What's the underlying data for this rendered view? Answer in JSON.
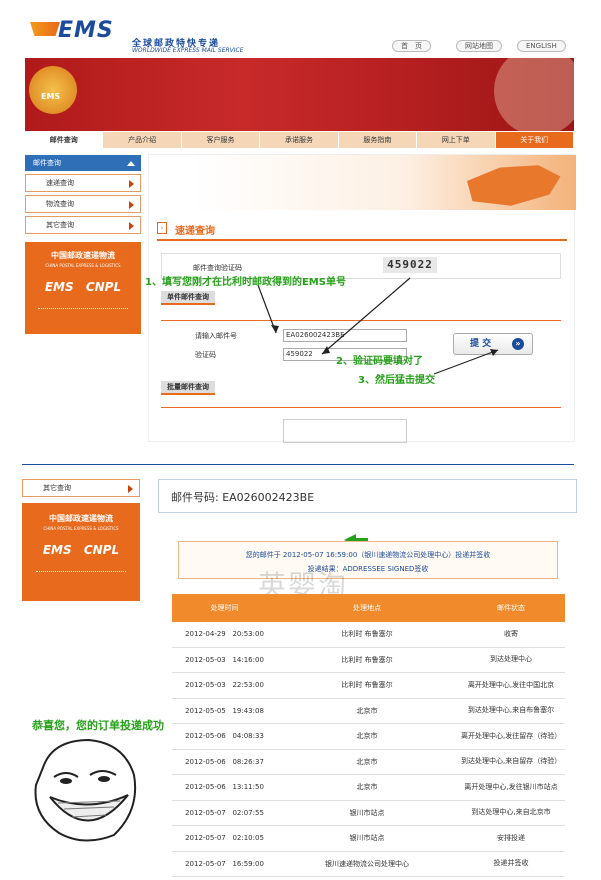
{
  "header": {
    "logo_text": "EMS",
    "logo_cn": "全球邮政特快专递",
    "logo_en": "WORLDWIDE EXPRESS MAIL SERVICE",
    "links": [
      "首　页",
      "网站地图",
      "ENGLISH"
    ]
  },
  "banner": {
    "badge": "EMS"
  },
  "nav": [
    "邮件查询",
    "产品介绍",
    "客户服务",
    "承诺服务",
    "服务指南",
    "网上下单",
    "关于我们"
  ],
  "sidebar": {
    "head": "邮件查询",
    "items": [
      "速递查询",
      "物流查询",
      "其它查询"
    ],
    "promo_cn": "中国邮政速递物流",
    "promo_en": "CHINA POSTAL EXPRESS & LOGISTICS",
    "promo_ems": "EMS",
    "promo_cnpl": "CNPL"
  },
  "form": {
    "title": "速递查询",
    "captcha_label": "邮件查询验证码",
    "captcha_value": "459022",
    "single_title": "单件邮件查询",
    "tracking_label": "请输入邮件号",
    "tracking_value": "EA026002423BE",
    "verify_label": "验证码",
    "verify_value": "459022",
    "submit": "提 交",
    "batch_title": "批量邮件查询"
  },
  "annotations": {
    "step1": "1、填写您刚才在比利时邮政得到的EMS单号",
    "step2": "2、验证码要填对了",
    "step3": "3、然后猛击提交",
    "congrats": "恭喜您，您的订单投递成功"
  },
  "result": {
    "sidebar_item": "其它查询",
    "title": "邮件号码: EA026002423BE",
    "notice_line1": "您的邮件于 2012-05-07 16:59:00（银川速递物流公司处理中心）投递并签收",
    "notice_line2": "投递结果：ADDRESSEE SIGNED签收",
    "watermark": "英婴淘",
    "headers": [
      "处理时间",
      "处理地点",
      "邮件状态"
    ],
    "rows": [
      {
        "date": "2012-04-29",
        "time": "20:53:00",
        "place": "比利时 布鲁塞尔",
        "status": "收寄"
      },
      {
        "date": "2012-05-03",
        "time": "14:16:00",
        "place": "比利时 布鲁塞尔",
        "status": "到达处理中心"
      },
      {
        "date": "2012-05-03",
        "time": "22:53:00",
        "place": "比利时 布鲁塞尔",
        "status": "离开处理中心,发往中国北京"
      },
      {
        "date": "2012-05-05",
        "time": "19:43:08",
        "place": "北京市",
        "status": "到达处理中心,来自布鲁塞尔"
      },
      {
        "date": "2012-05-06",
        "time": "04:08:33",
        "place": "北京市",
        "status": "离开处理中心,发往留存（待验）"
      },
      {
        "date": "2012-05-06",
        "time": "08:26:37",
        "place": "北京市",
        "status": "到达处理中心,来自留存（待验）"
      },
      {
        "date": "2012-05-06",
        "time": "13:11:50",
        "place": "北京市",
        "status": "离开处理中心,发往银川市站点"
      },
      {
        "date": "2012-05-07",
        "time": "02:07:55",
        "place": "银川市站点",
        "status": "到达处理中心,来自北京市"
      },
      {
        "date": "2012-05-07",
        "time": "02:10:05",
        "place": "银川市站点",
        "status": "安排投递"
      },
      {
        "date": "2012-05-07",
        "time": "16:59:00",
        "place": "银川速递物流公司处理中心",
        "status": "投递并签收"
      }
    ]
  },
  "colors": {
    "orange": "#e86a1c",
    "green": "#26a11a",
    "blue": "#1a4b9c"
  }
}
